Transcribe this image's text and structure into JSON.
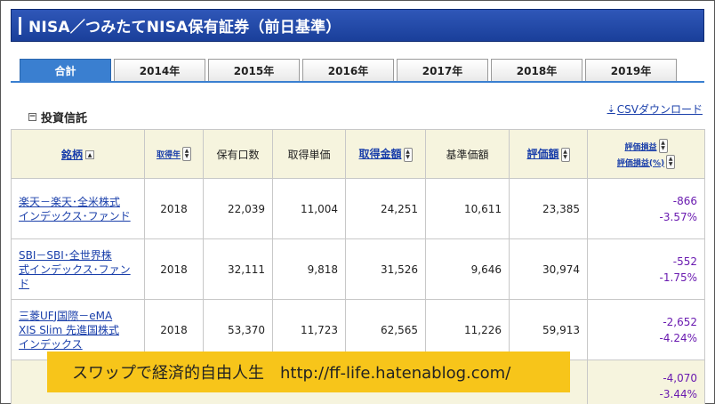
{
  "header": {
    "title": "NISA／つみたてNISA保有証券（前日基準）"
  },
  "tabs": [
    {
      "label": "合計",
      "active": true
    },
    {
      "label": "2014年",
      "active": false
    },
    {
      "label": "2015年",
      "active": false
    },
    {
      "label": "2016年",
      "active": false
    },
    {
      "label": "2017年",
      "active": false
    },
    {
      "label": "2018年",
      "active": false
    },
    {
      "label": "2019年",
      "active": false
    }
  ],
  "section": {
    "title": "投資信託",
    "csv_label": "CSVダウンロード"
  },
  "columns": {
    "name": "銘柄",
    "year": "取得年",
    "units": "保有口数",
    "unit_price": "取得単価",
    "cost": "取得金額",
    "nav": "基準価額",
    "value": "評価額",
    "pl": "評価損益",
    "pl_pct": "評価損益(%)"
  },
  "rows": [
    {
      "name_line1": "楽天－楽天･全米株式",
      "name_line2": "インデックス･ファンド",
      "name_line3": "",
      "year": "2018",
      "units": "22,039",
      "unit_price": "11,004",
      "cost": "24,251",
      "nav": "10,611",
      "value": "23,385",
      "pl": "-866",
      "pl_pct": "-3.57%"
    },
    {
      "name_line1": "SBI－SBI･全世界株",
      "name_line2": "式インデックス･ファン",
      "name_line3": "ド",
      "year": "2018",
      "units": "32,111",
      "unit_price": "9,818",
      "cost": "31,526",
      "nav": "9,646",
      "value": "30,974",
      "pl": "-552",
      "pl_pct": "-1.75%"
    },
    {
      "name_line1": "三菱UFJ国際－eMA",
      "name_line2": "XIS Slim 先進国株式",
      "name_line3": "インデックス",
      "year": "2018",
      "units": "53,370",
      "unit_price": "11,723",
      "cost": "62,565",
      "nav": "11,226",
      "value": "59,913",
      "pl": "-2,652",
      "pl_pct": "-4.24%"
    }
  ],
  "total": {
    "pl": "-4,070",
    "pl_pct": "-3.44%"
  },
  "watermark": {
    "text": "スワップで経済的自由人生　http://ff-life.hatenablog.com/"
  },
  "colors": {
    "header_bg": "#1a3f9a",
    "tab_active": "#3a7fd0",
    "table_header_bg": "#f6f4de",
    "link": "#1a3faa",
    "loss": "#6a1bb0",
    "watermark_bg": "#f7c51a"
  }
}
